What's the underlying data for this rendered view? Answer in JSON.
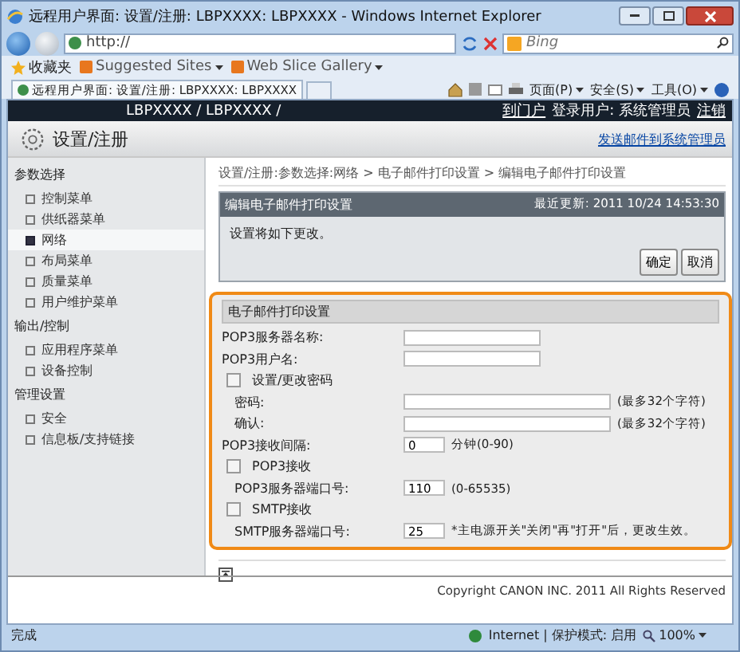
{
  "window": {
    "title": "远程用户界面: 设置/注册: LBPXXXX: LBPXXXX - Windows Internet Explorer"
  },
  "browser": {
    "address": "http://",
    "search_placeholder": "Bing",
    "favorites": "收藏夹",
    "links": [
      "Suggested Sites",
      "Web Slice Gallery"
    ],
    "tab": "远程用户界面: 设置/注册: LBPXXXX: LBPXXXX",
    "menus": [
      "页面(P)",
      "安全(S)",
      "工具(O)"
    ]
  },
  "header": {
    "product": "LBPXXXX / LBPXXXX /",
    "portal": "到门户",
    "user": "登录用户: 系统管理员",
    "logout": "注销"
  },
  "page": {
    "title": "设置/注册",
    "mail_link": "发送邮件到系统管理员"
  },
  "sidebar": {
    "groups": [
      {
        "title": "参数选择",
        "items": [
          {
            "label": "控制菜单",
            "selected": false
          },
          {
            "label": "供纸器菜单",
            "selected": false
          },
          {
            "label": "网络",
            "selected": true
          },
          {
            "label": "布局菜单",
            "selected": false
          },
          {
            "label": "质量菜单",
            "selected": false
          },
          {
            "label": "用户维护菜单",
            "selected": false
          }
        ]
      },
      {
        "title": "输出/控制",
        "items": [
          {
            "label": "应用程序菜单",
            "selected": false
          },
          {
            "label": "设备控制",
            "selected": false
          }
        ]
      },
      {
        "title": "管理设置",
        "items": [
          {
            "label": "安全",
            "selected": false
          },
          {
            "label": "信息板/支持链接",
            "selected": false
          }
        ]
      }
    ]
  },
  "breadcrumb": "设置/注册:参数选择:网络 > 电子邮件打印设置 > 编辑电子邮件打印设置",
  "panel": {
    "title": "编辑电子邮件打印设置",
    "updated": "最近更新: 2011 10/24 14:53:30",
    "message": "设置将如下更改。",
    "buttons": [
      "确定",
      "取消"
    ]
  },
  "form": {
    "title": "电子邮件打印设置",
    "rows": [
      {
        "kind": "field",
        "label": "POP3服务器名称:"
      },
      {
        "kind": "field",
        "label": "POP3用户名:"
      },
      {
        "kind": "checkbox",
        "label": "设置/更改密码",
        "checked": false,
        "children": [
          {
            "kind": "field",
            "label": "密码:",
            "note": "(最多32个字符)"
          },
          {
            "kind": "field",
            "label": "确认:",
            "note": "(最多32个字符)"
          }
        ]
      },
      {
        "kind": "field",
        "label": "POP3接收间隔:",
        "value": "0",
        "note": "分钟(0-90)"
      },
      {
        "kind": "checkbox",
        "label": "POP3接收",
        "checked": false,
        "children": [
          {
            "kind": "field",
            "label": "POP3服务器端口号:",
            "value": "110",
            "note": "(0-65535)"
          }
        ]
      },
      {
        "kind": "checkbox",
        "label": "SMTP接收",
        "checked": false,
        "children": [
          {
            "kind": "field",
            "label": "SMTP服务器端口号:",
            "value": "25",
            "note": "*主电源开关\"关闭\"再\"打开\"后，更改生效。"
          }
        ]
      }
    ]
  },
  "footer": {
    "copyright": "Copyright CANON INC. 2011 All Rights Reserved"
  },
  "status_bar": {
    "text": "完成",
    "zone": "Internet | 保护模式: 启用",
    "zoom": "100%"
  }
}
